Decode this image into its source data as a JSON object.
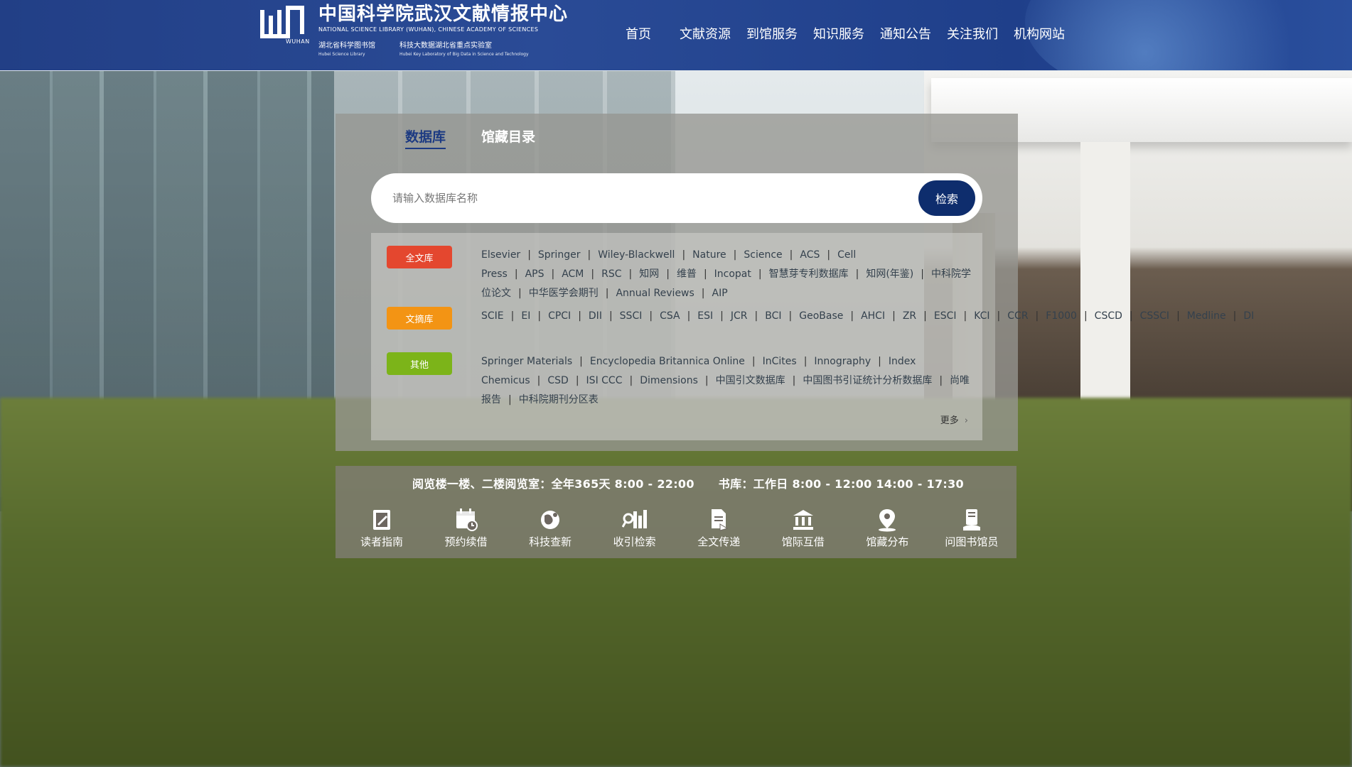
{
  "header": {
    "logo_cn": "中国科学院武汉文献情报中心",
    "logo_en": "NATIONAL SCIENCE LIBRARY (WUHAN), CHINESE ACADEMY OF SCIENCES",
    "logo_mark_text": "WUHAN",
    "sub1_cn": "湖北省科学图书馆",
    "sub1_en": "Hubei Science Library",
    "sub2_cn": "科技大数据湖北省重点实验室",
    "sub2_en": "Hubei Key Laboratory of Big Data in Science and Technology",
    "nav": [
      "首页",
      "文献资源",
      "到馆服务",
      "知识服务",
      "通知公告",
      "关注我们",
      "机构网站"
    ]
  },
  "search": {
    "tabs": [
      "数据库",
      "馆藏目录"
    ],
    "active_tab": "数据库",
    "placeholder": "请输入数据库名称",
    "button": "检索"
  },
  "categories": {
    "full": {
      "label": "全文库",
      "color": "#e4472f",
      "items": [
        "Elsevier",
        "Springer",
        "Wiley-Blackwell",
        "Nature",
        "Science",
        "ACS",
        "Cell Press",
        "APS",
        "ACM",
        "RSC",
        "知网",
        "维普",
        "Incopat",
        "智慧芽专利数据库",
        "知网(年鉴)",
        "中科院学位论文",
        "中华医学会期刊",
        "Annual Reviews",
        "AIP"
      ]
    },
    "abs": {
      "label": "文摘库",
      "color": "#f39414",
      "items": [
        "SCIE",
        "EI",
        "CPCI",
        "DII",
        "SSCI",
        "CSA",
        "ESI",
        "JCR",
        "BCI",
        "GeoBase",
        "AHCI",
        "ZR",
        "ESCI",
        "KCI",
        "CCR",
        "F1000",
        "CSCD",
        "CSSCI",
        "Medline",
        "DI"
      ]
    },
    "other": {
      "label": "其他",
      "color": "#7cb419",
      "items": [
        "Springer Materials",
        "Encyclopedia Britannica Online",
        "InCites",
        "Innography",
        "Index Chemicus",
        "CSD",
        "ISI CCC",
        "Dimensions",
        "中国引文数据库",
        "中国图书引证统计分析数据库",
        "尚唯报告",
        "中科院期刊分区表"
      ]
    },
    "more": "更多"
  },
  "hours": {
    "reading": "阅览楼一楼、二楼阅览室：全年365天 8:00 - 22:00",
    "stacks": "书库：工作日 8:00 - 12:00 14:00 - 17:30"
  },
  "services": [
    {
      "label": "读者指南",
      "icon": "book-icon"
    },
    {
      "label": "预约续借",
      "icon": "calendar-icon"
    },
    {
      "label": "科技查新",
      "icon": "globe-icon"
    },
    {
      "label": "收引检索",
      "icon": "search-chart-icon"
    },
    {
      "label": "全文传递",
      "icon": "document-icon"
    },
    {
      "label": "馆际互借",
      "icon": "bank-icon"
    },
    {
      "label": "馆藏分布",
      "icon": "location-icon"
    },
    {
      "label": "问图书馆员",
      "icon": "librarian-icon"
    }
  ]
}
